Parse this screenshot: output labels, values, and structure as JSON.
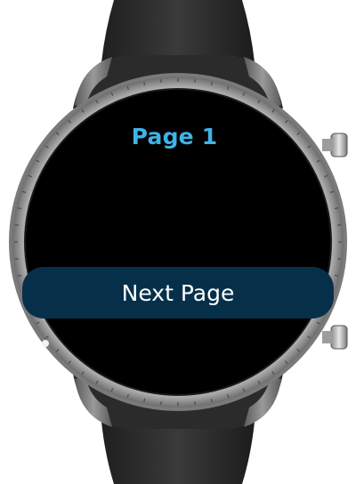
{
  "screen": {
    "title": "Page 1",
    "next_button_label": "Next Page"
  },
  "colors": {
    "title": "#3FB3E6",
    "button_background": "#06304A",
    "button_text": "#FFFFFF",
    "screen_background": "#000000"
  },
  "icons": {
    "page_indicator": "scroll-position-dot"
  }
}
